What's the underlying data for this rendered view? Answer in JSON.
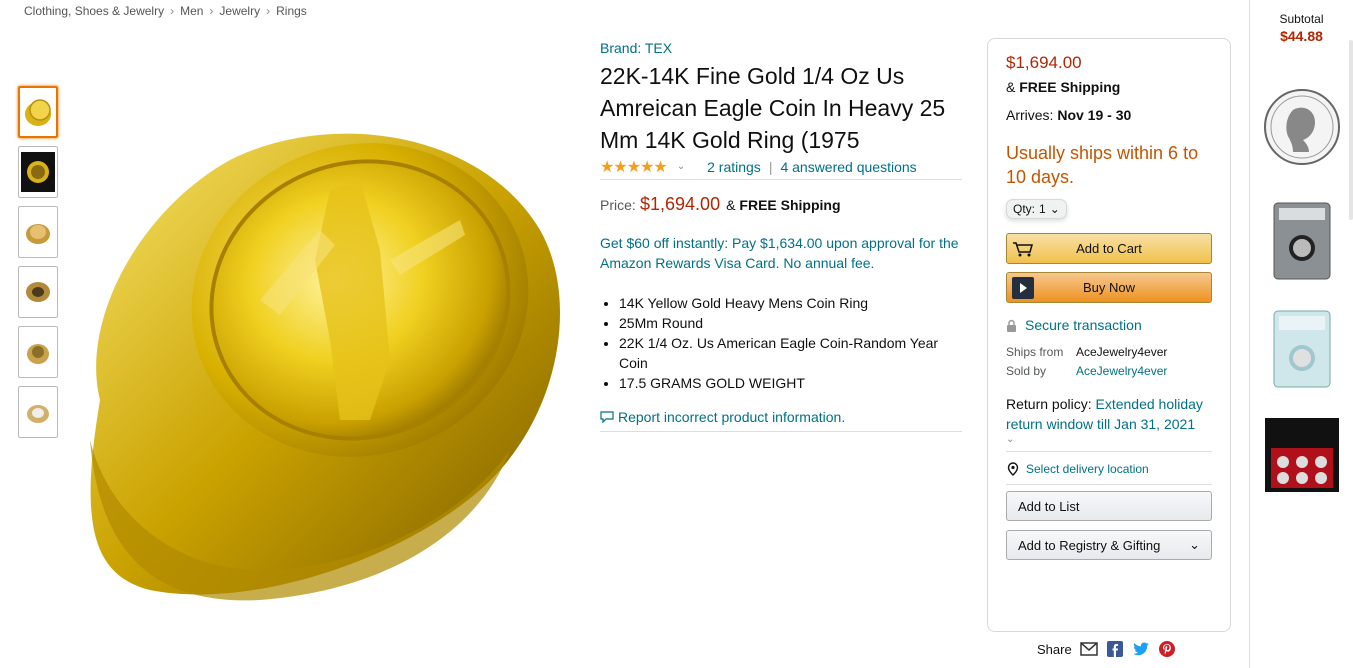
{
  "breadcrumb": [
    "Clothing, Shoes & Jewelry",
    "Men",
    "Jewelry",
    "Rings"
  ],
  "breadcrumb_sep": "›",
  "product": {
    "brand": "Brand: TEX",
    "title": "22K-14K Fine Gold 1/4 Oz Us Amreican Eagle Coin In Heavy 25 Mm 14K Gold Ring (1975",
    "stars": "★★★★★",
    "ratings": "2 ratings",
    "answered": "4 answered questions",
    "price_label": "Price:",
    "price": "$1,694.00",
    "amp": "&",
    "free_shipping": "FREE Shipping",
    "promo": "Get $60 off instantly: Pay $1,634.00 upon approval for the Amazon Rewards Visa Card. No annual fee.",
    "bullets": [
      "14K Yellow Gold Heavy Mens Coin Ring",
      "25Mm Round",
      "22K 1/4 Oz. Us American Eagle Coin-Random Year Coin",
      "17.5 GRAMS GOLD WEIGHT"
    ],
    "report": "Report incorrect product information."
  },
  "buybox": {
    "price": "$1,694.00",
    "ship_prefix": "&",
    "free_shipping": "FREE Shipping",
    "arrives_label": "Arrives:",
    "arrives_date": "Nov 19 - 30",
    "usually": "Usually ships within 6 to 10 days.",
    "qty_label": "Qty:",
    "qty_value": "1",
    "add_to_cart": "Add to Cart",
    "buy_now": "Buy Now",
    "secure": "Secure transaction",
    "ships_from_label": "Ships from",
    "ships_from": "AceJewelry4ever",
    "sold_by_label": "Sold by",
    "sold_by": "AceJewelry4ever",
    "return_label": "Return policy:",
    "return_link": "Extended holiday return window till Jan 31, 2021",
    "deliver": "Select delivery location",
    "add_to_list": "Add to List",
    "add_to_registry": "Add to Registry & Gifting"
  },
  "share_label": "Share",
  "rail": {
    "subtotal_label": "Subtotal",
    "subtotal_value": "$44.88"
  },
  "colors": {
    "link": "#007185",
    "price": "#b12704",
    "accent_orange": "#e77600",
    "ships": "#c45500"
  }
}
